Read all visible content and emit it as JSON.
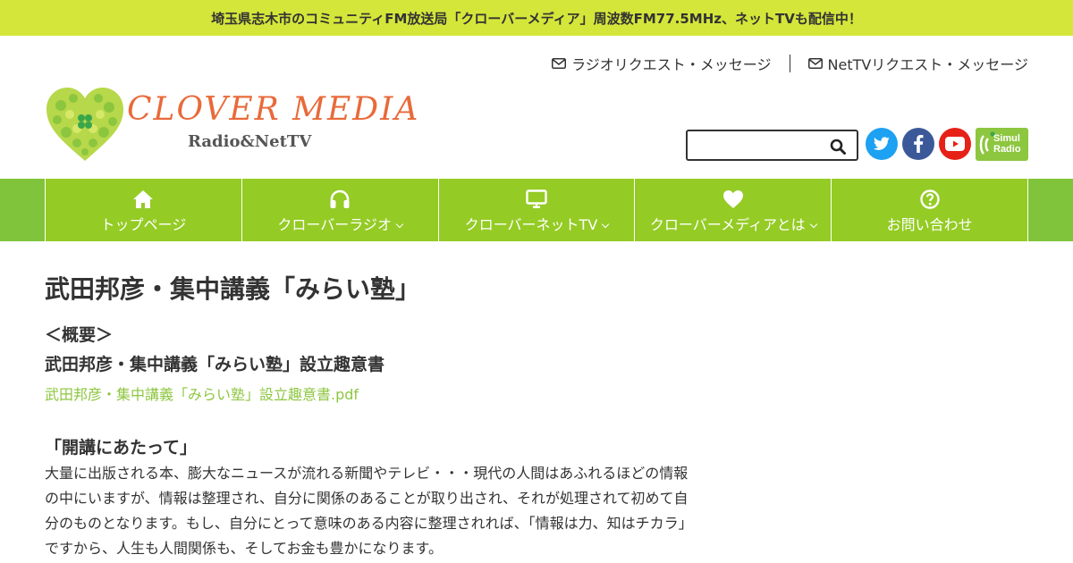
{
  "topbar": {
    "announcement": "埼玉県志木市のコミュニティFM放送局「クローバーメディア」周波数FM77.5MHz、ネットTVも配信中！",
    "bg_color": "#d4e63a"
  },
  "header": {
    "logo": {
      "title": "CLOVER MEDIA",
      "subtitle": "Radio&NetTV"
    },
    "request_links": [
      {
        "label": "ラジオリクエスト・メッセージ",
        "icon": "envelope-icon"
      },
      {
        "label": "NetTVリクエスト・メッセージ",
        "icon": "envelope-icon"
      }
    ],
    "search": {
      "value": "",
      "placeholder": "",
      "icon": "search-icon"
    },
    "social": [
      {
        "name": "twitter",
        "icon": "twitter-icon",
        "color": "#1da1f2"
      },
      {
        "name": "facebook",
        "icon": "facebook-icon",
        "color": "#3b5998"
      },
      {
        "name": "youtube",
        "icon": "youtube-icon",
        "color": "#e62117"
      },
      {
        "name": "simulradio",
        "icon": "simulradio-icon",
        "label": "Simul\nRadio",
        "color": "#8dc63f"
      }
    ]
  },
  "nav": {
    "bg_color": "#94cb25",
    "items": [
      {
        "label": "トップページ",
        "icon": "home-icon",
        "dropdown": false
      },
      {
        "label": "クローバーラジオ",
        "icon": "headphones-icon",
        "dropdown": true
      },
      {
        "label": "クローバーネットTV",
        "icon": "monitor-icon",
        "dropdown": true
      },
      {
        "label": "クローバーメディアとは",
        "icon": "heart-icon",
        "dropdown": true
      },
      {
        "label": "お問い合わせ",
        "icon": "question-circle-icon",
        "dropdown": false
      }
    ]
  },
  "main": {
    "title": "武田邦彦・集中講義「みらい塾」",
    "overview_heading": "＜概要＞",
    "doc_heading": "武田邦彦・集中講義「みらい塾」設立趣意書",
    "pdf_link": "武田邦彦・集中講義「みらい塾」設立趣意書.pdf",
    "opening_heading": "「開講にあたって」",
    "paragraph": "大量に出版される本、膨大なニュースが流れる新聞やテレビ・・・現代の人間はあふれるほどの情報の中にいますが、情報は整理され、自分に関係のあることが取り出され、それが処理されて初めて自分のものとなります。もし、自分にとって意味のある内容に整理されれば、「情報は力、知はチカラ」ですから、人生も人間関係も、そしてお金も豊かになります。",
    "link_color": "#8dc63f"
  }
}
